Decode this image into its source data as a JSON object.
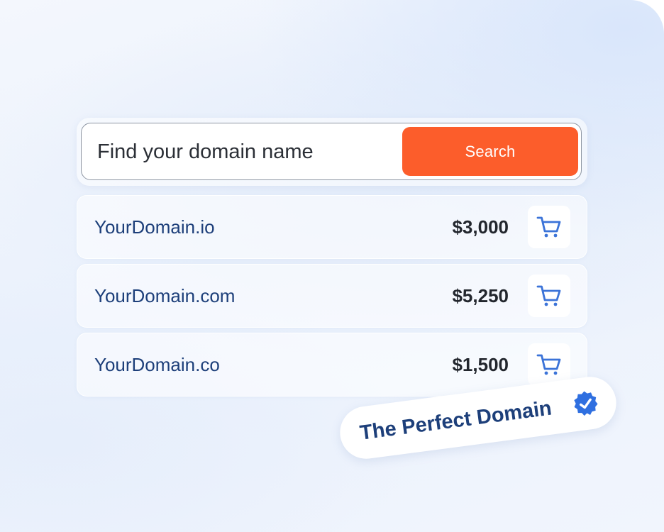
{
  "search": {
    "placeholder": "Find your domain name",
    "button_label": "Search"
  },
  "results": [
    {
      "domain": "YourDomain.io",
      "price": "$3,000",
      "icon": "cart-icon"
    },
    {
      "domain": "YourDomain.com",
      "price": "$5,250",
      "icon": "cart-icon"
    },
    {
      "domain": "YourDomain.co",
      "price": "$1,500",
      "icon": "cart-icon"
    }
  ],
  "badge": {
    "label": "The Perfect Domain",
    "icon": "verified-check-icon"
  },
  "colors": {
    "accent": "#fc5d2b",
    "domain_text": "#1d3f7a",
    "price_text": "#22262d",
    "cart_icon": "#3b73d8",
    "verified": "#2f6fe0"
  }
}
